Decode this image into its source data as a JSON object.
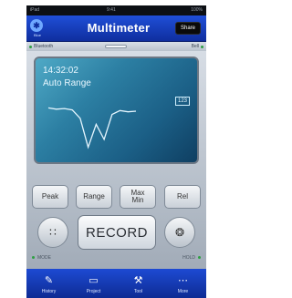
{
  "statusbar": {
    "carrier": "iPad",
    "time": "9:41",
    "battery": "100%"
  },
  "header": {
    "bluetooth_label": "Blue",
    "title": "Multimeter",
    "share_label": "Share"
  },
  "bluetooth_bar": {
    "left_label": "Bluetooth",
    "right_label": "Bell"
  },
  "display": {
    "time": "14:32:02",
    "mode": "Auto Range",
    "reading": "123",
    "waveform": [
      0.2,
      0.22,
      0.21,
      0.23,
      0.36,
      0.8,
      0.45,
      0.68,
      0.3,
      0.24,
      0.26,
      0.25
    ]
  },
  "buttons": {
    "peak": "Peak",
    "range": "Range",
    "maxmin_line1": "Max",
    "maxmin_line2": "Min",
    "rel": "Rel",
    "record": "RECORD",
    "mode_label": "MODE",
    "hold_label": "HOLD"
  },
  "tabs": [
    {
      "label": "History",
      "icon": "history-icon"
    },
    {
      "label": "Project",
      "icon": "project-icon"
    },
    {
      "label": "Tool",
      "icon": "tool-icon"
    },
    {
      "label": "More",
      "icon": "more-icon"
    }
  ]
}
